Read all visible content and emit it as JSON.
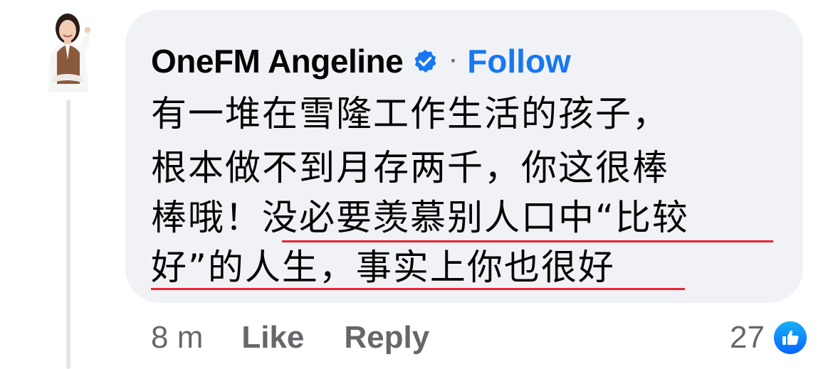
{
  "comment": {
    "author": "OneFM Angeline",
    "verified": true,
    "separator": "·",
    "follow_label": "Follow",
    "text_lines": [
      "有一堆在雪隆工作生活的孩子，",
      "根本做不到月存两千，你这很棒",
      "棒哦！没必要羡慕别人口中“比较",
      "好”的人生，事实上你也很好"
    ],
    "timestamp": "8 m",
    "like_label": "Like",
    "reply_label": "Reply",
    "reaction_count": "27",
    "reaction_icon": "thumbs-up-icon"
  },
  "colors": {
    "bubble": "#f0f2f5",
    "follow": "#1877f2",
    "underline": "#e8232f",
    "muted": "#65676b"
  }
}
